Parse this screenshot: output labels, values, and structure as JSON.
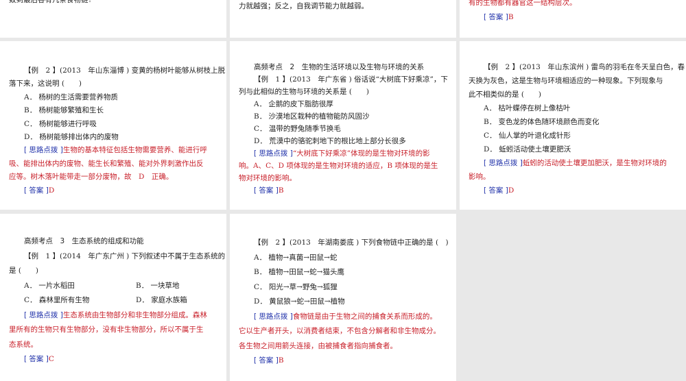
{
  "slides": [
    {
      "id": "r1c1",
      "lines": [
        {
          "k": "q",
          "t": "致到最后各有几条食物链?"
        }
      ]
    },
    {
      "id": "r1c2",
      "lines": [
        {
          "k": "q",
          "t": "力就越强；反之，自我调节能力就越弱。"
        }
      ]
    },
    {
      "id": "r1c3",
      "lines": [
        {
          "k": "red",
          "t": "有的生物都有器官这一结构层次。"
        },
        {
          "k": "ans",
          "label": "[ 答案 ]",
          "t": "B"
        }
      ]
    },
    {
      "id": "r2c1",
      "lines": [
        {
          "k": "qi",
          "t": "【例　2 】(2013　年山东淄博 ) 变黄的杨树叶能够从树枝上脱"
        },
        {
          "k": "q",
          "t": "落下来，这说明 (　　)"
        },
        {
          "k": "opt",
          "t": "A． 杨树的生活需要营养物质"
        },
        {
          "k": "opt",
          "t": "B． 杨树能够繁殖和生长"
        },
        {
          "k": "opt",
          "t": "C． 杨树能够进行呼吸"
        },
        {
          "k": "opt",
          "t": "D． 杨树能够排出体内的废物"
        },
        {
          "k": "tip",
          "label": "[ 思路点拨 ]",
          "t": "生物的基本特征包括生物需要营养、能进行呼"
        },
        {
          "k": "red",
          "t": "吸、能排出体内的废物、能生长和繁殖、能对外界刺激作出反"
        },
        {
          "k": "red",
          "t": "应等。树木落叶能带走一部分废物，故　D　正确。"
        },
        {
          "k": "ans",
          "label": "[ 答案 ]",
          "t": "D"
        }
      ]
    },
    {
      "id": "r2c2",
      "lines": [
        {
          "k": "h",
          "t": "高频考点　2　生物的生活环境以及生物与环境的关系"
        },
        {
          "k": "qi",
          "t": "【例　1 】(2013　年广东省 ) 俗话说“大树底下好乘凉”，下"
        },
        {
          "k": "q",
          "t": "列与此相似的生物与环境的关系是 (　　)"
        },
        {
          "k": "opt",
          "t": "A． 企鹅的皮下脂肪很厚"
        },
        {
          "k": "opt",
          "t": "B． 沙漠地区栽种的植物能防风固沙"
        },
        {
          "k": "opt",
          "t": "C． 温带的野兔随季节换毛"
        },
        {
          "k": "opt",
          "t": "D． 荒漠中的骆驼刺地下的根比地上部分长很多"
        },
        {
          "k": "tip",
          "label": "[ 思路点拨 ]",
          "t": "“大树底下好乘凉”体现的是生物对环境的影"
        },
        {
          "k": "red",
          "t": "响。A、C、D 项体现的是生物对环境的适应，B 项体现的是生"
        },
        {
          "k": "red",
          "t": "物对环境的影响。"
        },
        {
          "k": "ans",
          "label": "[ 答案 ]",
          "t": "B"
        }
      ]
    },
    {
      "id": "r2c3",
      "lines": [
        {
          "k": "qi",
          "t": "【例　2 】(2013　年山东滨州 ) 雷鸟的羽毛在冬天呈白色，春"
        },
        {
          "k": "q",
          "t": "天换为灰色，这是生物与环境相适应的一种现象。下列现象与"
        },
        {
          "k": "q",
          "t": " 此不相类似的是 (　　)"
        },
        {
          "k": "opt",
          "t": "A． 枯叶蝶停在树上像枯叶"
        },
        {
          "k": "opt",
          "t": "B． 变色龙的体色随环境颜色而变化"
        },
        {
          "k": "opt",
          "t": "C． 仙人掌的叶退化成针形"
        },
        {
          "k": "opt",
          "t": "D． 蚯蚓活动使土壤更肥沃"
        },
        {
          "k": "tip",
          "label": "[ 思路点拨 ]",
          "t": "蚯蚓的活动使土壤更加肥沃，是生物对环境的"
        },
        {
          "k": "red",
          "t": "影响。"
        },
        {
          "k": "ans",
          "label": "[ 答案 ]",
          "t": "D"
        }
      ]
    },
    {
      "id": "r3c1",
      "lines": [
        {
          "k": "h",
          "t": "高频考点　3　生态系统的组成和功能"
        },
        {
          "k": "qi",
          "t": "【例　1 】(2014　年广东广州 ) 下列叙述中不属于生态系统的"
        },
        {
          "k": "q",
          "t": "是 (　　)"
        },
        {
          "k": "opt2",
          "t": "A． 一片水稻田",
          "t2": "B． 一块草地"
        },
        {
          "k": "opt2",
          "t": "C． 森林里所有生物",
          "t2": "D． 家庭水族箱"
        },
        {
          "k": "tip",
          "label": "[ 思路点拨 ]",
          "t": "生态系统由生物部分和非生物部分组成。森林"
        },
        {
          "k": "red",
          "t": "里所有的生物只有生物部分，没有非生物部分，所以不属于生"
        },
        {
          "k": "red",
          "t": "态系统。"
        },
        {
          "k": "ans",
          "label": "[ 答案 ]",
          "t": "C"
        }
      ]
    },
    {
      "id": "r3c2",
      "lines": [
        {
          "k": "qi",
          "t": "【例　2 】(2013　年湖南娄底 ) 下列食物链中正确的是 (　)"
        },
        {
          "k": "opt",
          "t": "A． 植物→真菌→田鼠→蛇"
        },
        {
          "k": "opt",
          "t": "B． 植物→田鼠→蛇→猫头鹰"
        },
        {
          "k": "opt",
          "t": "C． 阳光→草→野兔→狐狸"
        },
        {
          "k": "opt",
          "t": "D． 黄鼠狼→蛇→田鼠→植物"
        },
        {
          "k": "tip",
          "label": "[ 思路点拨 ]",
          "t": "食物链是由于生物之间的捕食关系而形成的。"
        },
        {
          "k": "red",
          "t": "它以生产者开头，以消费者结束，不包含分解者和非生物成分。"
        },
        {
          "k": "red",
          "t": "各生物之间用箭头连接，由被捕食者指向捕食者。"
        },
        {
          "k": "ans",
          "label": "[ 答案 ]",
          "t": "B"
        }
      ]
    }
  ]
}
